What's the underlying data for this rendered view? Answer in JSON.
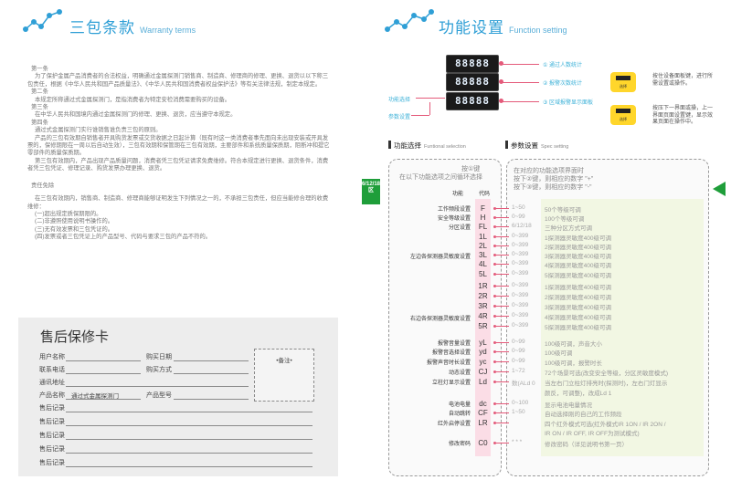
{
  "left": {
    "title": "三包条款",
    "title_en": "Warranty terms",
    "paragraphs": [
      "第一条",
      "为了保护金属产品消费者的合法权益，明确通过金属探测门销售商、制造商、修理商的修理、更换、退货以以下称三包责任，根据《中华人民共和国产品质量法》、《中华人民共和国消费者权益保护法》等有关法律法规，制定本规定。",
      "第二条",
      "本规定所称通过式金属探测门，是指消费者为特定安检消费需要购买的设备。",
      "第三条",
      "在中华人民共和国境内通过金属探测门的修理、更换、退货，应当遵守本规定。",
      "第四条",
      "通过式金属探测门实行谁销售谁负责三包的原则。",
      "产品的三包有效期自销售者开具购货发票或交货收据之日起计算（既有时这一类消费者事先面向未出现安装或开具发票的，保修期限在一周以后自动生效），三包有效期和保管期在三包有效期，主要部件和系统质量保质期，阻断冲和提它零部件的质量保质期。",
      "第三包有效期内，产品出现产品质量问题，消费者凭三包凭证请求免费维修。符合本规定进行更换、退货条件，消费者凭三包凭证、修理记录、购货发票办理更换、退货。",
      "责任免除",
      "在三包有效期内，销售商、制造商、修理商能够证明发生下列情况之一的，不承担三包责任，但应当能修合理的收费维修：",
      "(一)超出规定质保期限的。",
      "(二)非遵照使用说明书操作的。",
      "(三)无有效发票和三包凭证的。",
      "(四)发票或者三包凭证上的产品型号、代码与要求三包的产品不符的。"
    ],
    "card": {
      "title": "售后保修卡",
      "labels": {
        "user_name": "用户名称",
        "phone": "联系电话",
        "address": "通讯地址",
        "product_name": "产品名称",
        "service_records": "售后记录",
        "purchase_date": "购买日期",
        "purchase_method": "购买方式",
        "product_model": "产品型号"
      },
      "product_name_value": "通过式金属探测门",
      "note": "•备注•"
    }
  },
  "right": {
    "title": "功能设置",
    "title_en": "Function setting",
    "led_values": [
      "88888",
      "88888",
      "88888"
    ],
    "led_labels": [
      "① 通过人数统计",
      "② 报警次数统计",
      "③ 区域报警显示面板"
    ],
    "left_labels": [
      "功能选择",
      "参数设置"
    ],
    "button_labels": [
      "选择",
      "选择"
    ],
    "notes": [
      "按住设备面板键，进行所需设置或操作。",
      "按压下一界面或操，上一界面页面设置键，显示效果页面在操作中。"
    ],
    "side_flag": "6/12/18区",
    "func_panel": {
      "label": "功能选择",
      "label_en": "Funtional selection",
      "intro_line1": "按①键",
      "intro_line2": "在以下功能选项之间循环选择",
      "col_func": "功能",
      "col_code": "代码"
    },
    "param_panel": {
      "label": "参数设置",
      "label_en": "Spec setting",
      "intro_lines": [
        "在对应的功能选项界面时",
        "按下②键，则相应的数字 \"+\"",
        "按下③键，则相应的数字 \"-\""
      ]
    },
    "rows": [
      {
        "label": "工作频段设置",
        "code": "F",
        "range": "1~50",
        "desc": "50个等级可调"
      },
      {
        "label": "安全等级设置",
        "code": "H",
        "range": "0~99",
        "desc": "100个等级可调"
      },
      {
        "label": "分区设置",
        "code": "FL",
        "range": "6/12/18",
        "desc": "三种分区方式可调"
      },
      {
        "label": "",
        "code": "1L",
        "range": "0~399",
        "desc": "1探测器灵敏度400级可调"
      },
      {
        "label": "",
        "code": "2L",
        "range": "0~399",
        "desc": "2探测器灵敏度400级可调"
      },
      {
        "label": "左边各探测器灵敏度设置",
        "code": "3L",
        "range": "0~399",
        "desc": "3探测器灵敏度400级可调"
      },
      {
        "label": "",
        "code": "4L",
        "range": "0~399",
        "desc": "4探测器灵敏度400级可调"
      },
      {
        "label": "",
        "code": "5L",
        "range": "0~399",
        "desc": "5探测器灵敏度400级可调"
      },
      {
        "label": "",
        "code": "1R",
        "range": "0~399",
        "desc": "1探测器灵敏度400级可调"
      },
      {
        "label": "",
        "code": "2R",
        "range": "0~399",
        "desc": "2探测器灵敏度400级可调"
      },
      {
        "label": "右边各探测器灵敏度设置",
        "code": "3R",
        "range": "0~399",
        "desc": "3探测器灵敏度400级可调"
      },
      {
        "label": "",
        "code": "4R",
        "range": "0~399",
        "desc": "4探测器灵敏度400级可调"
      },
      {
        "label": "",
        "code": "5R",
        "range": "0~399",
        "desc": "5探测器灵敏度400级可调"
      },
      {
        "label": "报警音量设置",
        "code": "yL",
        "range": "0~99",
        "desc": "100级可调，声音大小"
      },
      {
        "label": "报警音选择设置",
        "code": "yd",
        "range": "0~99",
        "desc": "100级可调"
      },
      {
        "label": "报警声音时长设置",
        "code": "yc",
        "range": "0~99",
        "desc": "100级可调，报警时长"
      },
      {
        "label": "动态设置",
        "code": "CJ",
        "range": "1~72",
        "desc": "72个场景可选(改变安全等级，分区灵敏度模式)"
      },
      {
        "label": "立柱灯显示设置",
        "code": "Ld",
        "range": "数(ALd 0",
        "desc": "当左右门立柱灯排亮时(探测时)，左右门灯显示"
      },
      {
        "label": "",
        "code": "",
        "range": "",
        "desc": "颜反，可调整)，改成Ld 1"
      },
      {
        "label": "电池电量",
        "code": "dc",
        "range": "0~100",
        "desc": "显示电池电量情况"
      },
      {
        "label": "自动跳转",
        "code": "CF",
        "range": "1~50",
        "desc": "自动选择刚的自己的工作频段"
      },
      {
        "label": "红外启停设置",
        "code": "LR",
        "range": "",
        "desc": "四个红外模式可选(红外模式IR 1ON / IR 2ON / "
      },
      {
        "label": "",
        "code": "",
        "range": "",
        "desc": "IR ON / IR OFF, IR OFF为测试模式)"
      },
      {
        "label": "修改密码",
        "code": "C0",
        "range": "* * *",
        "desc": "修改密码（详见说明书第一页）"
      }
    ]
  }
}
